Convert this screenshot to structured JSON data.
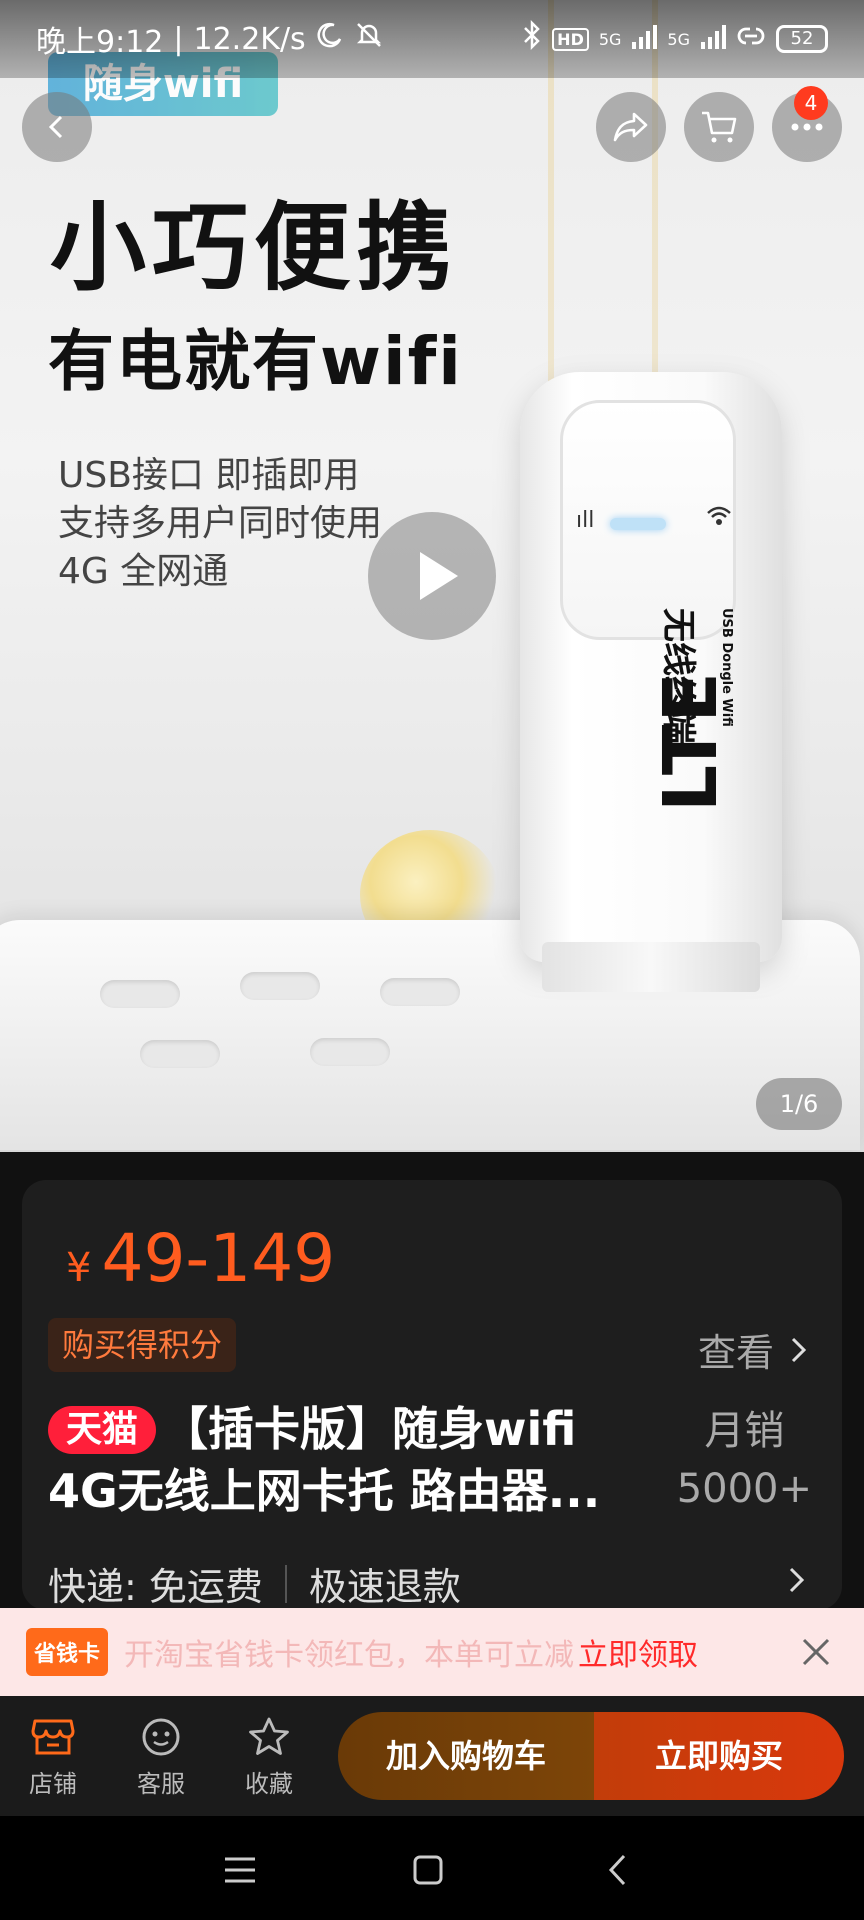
{
  "status_bar": {
    "time": "晚上9:12",
    "net_speed": "12.2K/s",
    "hd_label": "HD",
    "signal1": "5G",
    "signal2": "5G",
    "battery": "52"
  },
  "hero": {
    "brand": "随身wifi",
    "headline": "小巧便携",
    "subhead": "有电就有wifi",
    "features": [
      "USB接口 即插即用",
      "支持多用户同时使用",
      "4G 全网通"
    ],
    "device_label_lte": "LTE",
    "device_label_cn": "无线终端",
    "device_label_en": "USB Dongle Wifi",
    "page_indicator": "1/6"
  },
  "top_nav": {
    "cart_badge": "4"
  },
  "product": {
    "currency": "¥",
    "price": "49-149",
    "points_tag": "购买得积分",
    "view_label": "查看",
    "tmall_tag": "天猫",
    "title_line1": "【插卡版】随身wifi",
    "title_line2": "4G无线上网卡托 路由器...",
    "sales_label": "月销",
    "sales_count": "5000+",
    "shipping_label": "快递: 免运费",
    "refund_label": "极速退款"
  },
  "promo": {
    "tag": "省钱卡",
    "text": "开淘宝省钱卡领红包，本单可立减",
    "claim": "立即领取"
  },
  "action_bar": {
    "shop": "店铺",
    "service": "客服",
    "favorite": "收藏",
    "add_to_cart": "加入购物车",
    "buy_now": "立即购买"
  },
  "colors": {
    "price": "#ff5c1f",
    "tmall": "#ff1f3a",
    "buy": "#d9380c",
    "cart": "#7d4508"
  }
}
